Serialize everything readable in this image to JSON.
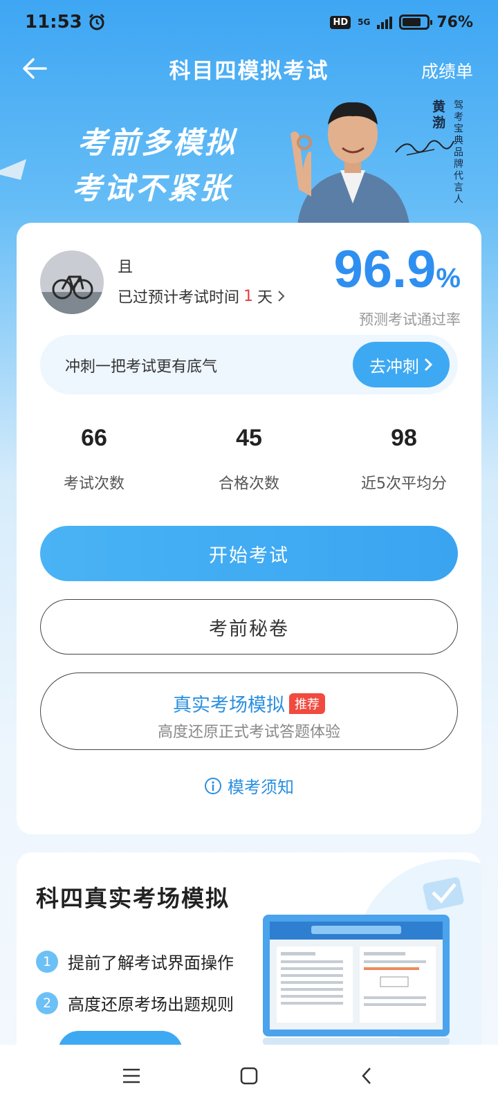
{
  "status_bar": {
    "time": "11:53",
    "network": "5G",
    "hd": "HD",
    "battery": "76%"
  },
  "nav": {
    "title": "科目四模拟考试",
    "right_label": "成绩单"
  },
  "hero": {
    "slogan_line1": "考前多模拟",
    "slogan_line2": "考试不紧张",
    "spokesperson_name": "黄渤",
    "spokesperson_role": "驾考宝典品牌代言人"
  },
  "user": {
    "name": "且",
    "exam_time_prefix": "已过预计考试时间",
    "exam_time_days": "1",
    "exam_time_suffix": "天"
  },
  "pass_rate": {
    "value": "96.9",
    "unit": "%",
    "label": "预测考试通过率"
  },
  "sprint": {
    "text": "冲刺一把考试更有底气",
    "button": "去冲刺"
  },
  "stats": [
    {
      "value": "66",
      "label": "考试次数"
    },
    {
      "value": "45",
      "label": "合格次数"
    },
    {
      "value": "98",
      "label": "近5次平均分"
    }
  ],
  "buttons": {
    "start": "开始考试",
    "secret": "考前秘卷",
    "real_title": "真实考场模拟",
    "real_badge": "推荐",
    "real_sub": "高度还原正式考试答题体验",
    "notice": "模考须知"
  },
  "real_section": {
    "title": "科四真实考场模拟",
    "features": [
      {
        "num": "1",
        "text": "提前了解考试界面操作"
      },
      {
        "num": "2",
        "text": "高度还原考场出题规则"
      }
    ]
  },
  "colors": {
    "primary": "#3ea9f3",
    "accent_text": "#2a8fe0",
    "badge_red": "#f14a3f",
    "rate_blue": "#2f8ff0"
  }
}
